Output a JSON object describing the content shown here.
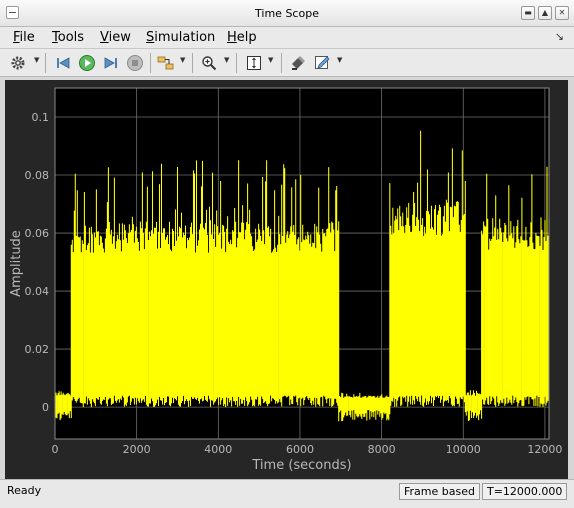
{
  "window": {
    "title": "Time Scope"
  },
  "menu": {
    "items": [
      {
        "label": "File",
        "mnemonic": "F",
        "rest": "ile"
      },
      {
        "label": "Tools",
        "mnemonic": "T",
        "rest": "ools"
      },
      {
        "label": "View",
        "mnemonic": "V",
        "rest": "iew"
      },
      {
        "label": "Simulation",
        "mnemonic": "S",
        "rest": "imulation"
      },
      {
        "label": "Help",
        "mnemonic": "H",
        "rest": "elp"
      }
    ]
  },
  "toolbar": {
    "icons": [
      "gear-icon",
      "step-back-icon",
      "run-icon",
      "step-forward-icon",
      "stop-icon",
      "signal-select-icon",
      "zoom-in-icon",
      "scale-axes-icon",
      "highlight-icon",
      "style-edit-icon"
    ]
  },
  "colors": {
    "plot_bg": "#000000",
    "axes_bg": "#262626",
    "trace": "#ffff00",
    "grid": "#6e6e6e",
    "tick_text": "#b8b8b8"
  },
  "chart_data": {
    "type": "line",
    "xlabel": "Time (seconds)",
    "ylabel": "Amplitude",
    "xlim": [
      0,
      12100
    ],
    "ylim": [
      -0.011,
      0.11
    ],
    "xticks": [
      0,
      2000,
      4000,
      6000,
      8000,
      10000,
      12000
    ],
    "yticks": [
      0,
      0.02,
      0.04,
      0.06,
      0.08,
      0.1
    ],
    "xtick_labels": [
      "0",
      "2000",
      "4000",
      "6000",
      "8000",
      "10000",
      "12000"
    ],
    "ytick_labels": [
      "0",
      "0.02",
      "0.04",
      "0.06",
      "0.08",
      "0.1"
    ],
    "grid": true,
    "series": [
      {
        "color": "#ffff00",
        "segments": [
          {
            "start": 0,
            "end": 400,
            "low": -0.001,
            "high": 0.005,
            "peak": 0.006
          },
          {
            "start": 400,
            "end": 6950,
            "low": 0.004,
            "high": 0.064,
            "peak": 0.086
          },
          {
            "start": 6950,
            "end": 8200,
            "low": -0.001,
            "high": 0.004,
            "peak": 0.005
          },
          {
            "start": 8200,
            "end": 10050,
            "low": 0.004,
            "high": 0.071,
            "peak": 0.098
          },
          {
            "start": 10050,
            "end": 10450,
            "low": -0.001,
            "high": 0.005,
            "peak": 0.006
          },
          {
            "start": 10450,
            "end": 12100,
            "low": 0.004,
            "high": 0.065,
            "peak": 0.083
          }
        ]
      }
    ]
  },
  "status": {
    "left": "Ready",
    "frame": "Frame based",
    "time": "T=12000.000"
  }
}
